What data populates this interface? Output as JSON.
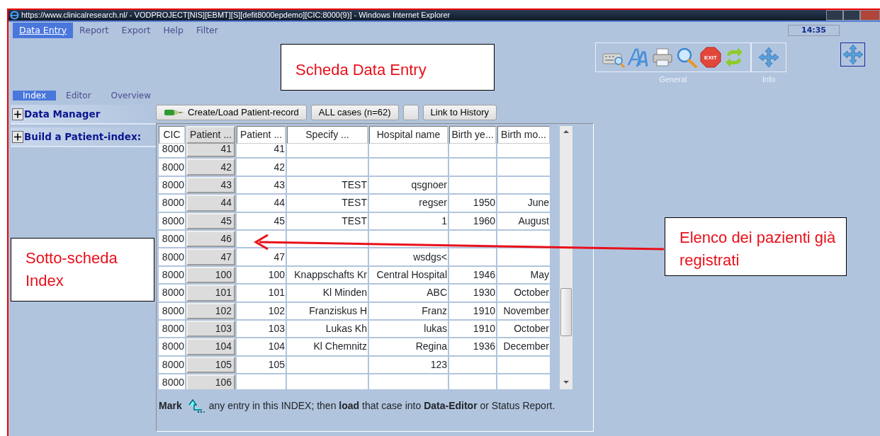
{
  "window": {
    "title": "https://www.clinicalresearch.nl/ - VODPROJECT[NIS][EBMT][S][defit8000epdemo][CIC:8000(9)] - Windows Internet Explorer"
  },
  "menu": [
    {
      "label": "Data Entry",
      "selected": true
    },
    {
      "label": "Report",
      "selected": false
    },
    {
      "label": "Export",
      "selected": false
    },
    {
      "label": "Help",
      "selected": false
    },
    {
      "label": "Filter",
      "selected": false
    }
  ],
  "clock": "14:35",
  "toolbar": {
    "groups": [
      {
        "label": "General",
        "exit_label": "EXIT"
      },
      {
        "label": "Info"
      }
    ]
  },
  "sub_tabs": [
    {
      "label": "Index",
      "selected": true
    },
    {
      "label": "Editor",
      "selected": false
    },
    {
      "label": "Overview",
      "selected": false
    }
  ],
  "sidebar": {
    "items": [
      {
        "label": "Data Manager",
        "expanded": false
      },
      {
        "label": "Build a Patient-index:",
        "expanded": false
      }
    ]
  },
  "buttons": [
    {
      "kind": "icon-text",
      "label": "Create/Load Patient-record"
    },
    {
      "kind": "text",
      "label": "ALL cases (n=62)"
    },
    {
      "kind": "blank"
    },
    {
      "kind": "text",
      "label": "Link to History"
    }
  ],
  "table": {
    "columns": [
      {
        "label": "CIC",
        "kind": "text"
      },
      {
        "label": "Patient ...",
        "kind": "button"
      },
      {
        "label": "Patient ...",
        "kind": "text"
      },
      {
        "label": "Specify ...",
        "kind": "text"
      },
      {
        "label": "Hospital name",
        "kind": "text"
      },
      {
        "label": "Birth ye...",
        "kind": "text"
      },
      {
        "label": "Birth mo...",
        "kind": "text"
      }
    ],
    "rows": [
      [
        "8000",
        "41",
        "41",
        null,
        null,
        null,
        null
      ],
      [
        "8000",
        "42",
        "42",
        null,
        null,
        null,
        null
      ],
      [
        "8000",
        "43",
        "43",
        "TEST",
        "qsgnoer",
        null,
        null
      ],
      [
        "8000",
        "44",
        "44",
        "TEST",
        "regser",
        "1950",
        "June"
      ],
      [
        "8000",
        "45",
        "45",
        "TEST",
        "1",
        "1960",
        "August"
      ],
      [
        "8000",
        "46",
        null,
        null,
        null,
        null,
        null
      ],
      [
        "8000",
        "47",
        "47",
        null,
        "wsdgs<",
        null,
        null
      ],
      [
        "8000",
        "100",
        "100",
        "Knappschafts Kr",
        "Central Hospital",
        "1946",
        "May"
      ],
      [
        "8000",
        "101",
        "101",
        "Kl Minden",
        "ABC",
        "1930",
        "October"
      ],
      [
        "8000",
        "102",
        "102",
        "Franziskus H",
        "Franz",
        "1910",
        "November"
      ],
      [
        "8000",
        "103",
        "103",
        "Lukas Kh",
        "lukas",
        "1910",
        "October"
      ],
      [
        "8000",
        "104",
        "104",
        "Kl Chemnitz",
        "Regina",
        "1936",
        "December"
      ],
      [
        "8000",
        "105",
        "105",
        null,
        "123",
        null,
        null
      ],
      [
        "8000",
        "106",
        null,
        null,
        null,
        null,
        null
      ]
    ]
  },
  "footer": {
    "mark_label": "Mark",
    "text": "any entry in this INDEX; then **load** that case into **Data-Editor** or Status Report."
  },
  "annotations": [
    {
      "kind": "title-callout",
      "text": "Scheda Data Entry"
    },
    {
      "kind": "side-callout",
      "text": "Sotto-scheda Index"
    },
    {
      "kind": "arrow-callout",
      "text": "Elenco dei pazienti già registrati"
    }
  ]
}
